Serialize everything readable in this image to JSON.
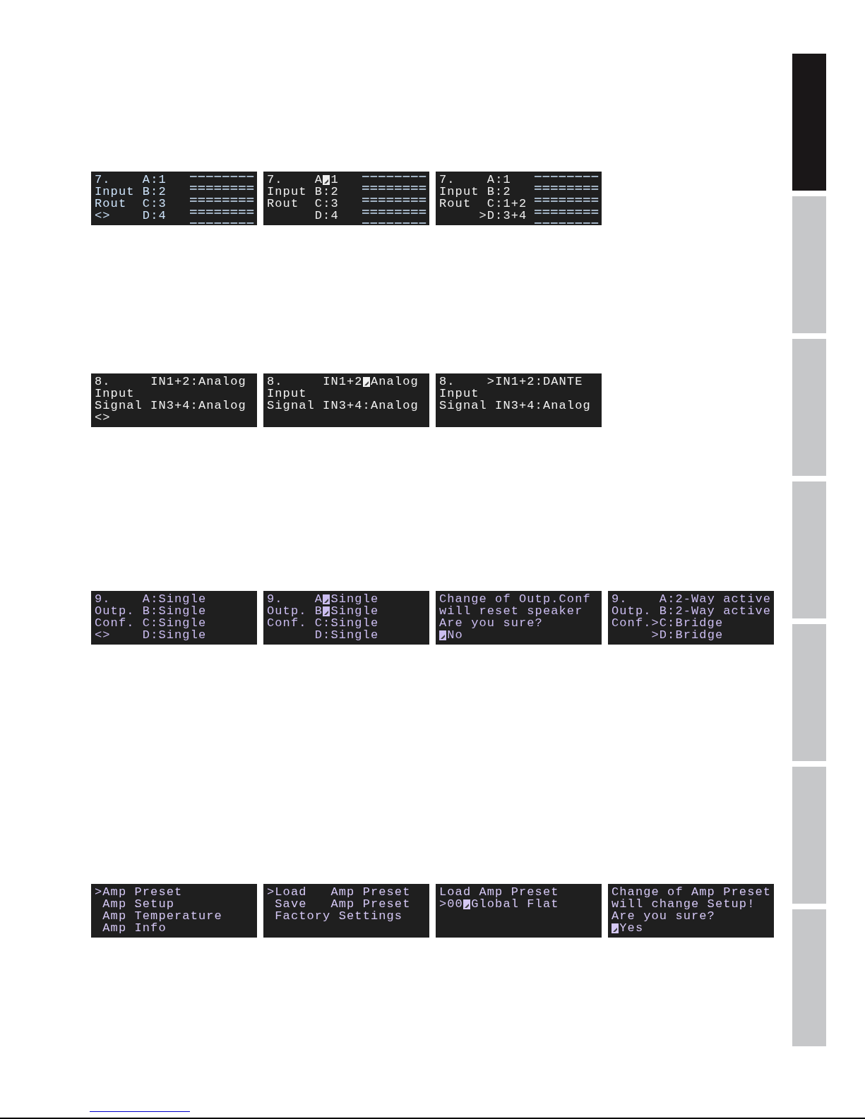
{
  "screen_rows": [
    {
      "screens": [
        {
          "meter": true,
          "lines": [
            [
              {
                "kind": "text",
                "text": "7.    A:1"
              }
            ],
            [
              {
                "kind": "text",
                "text": "Input B:2"
              }
            ],
            [
              {
                "kind": "text",
                "text": "Rout  C:3"
              }
            ],
            [
              {
                "kind": "text",
                "text": "<>    D:4"
              }
            ]
          ]
        },
        {
          "meter": true,
          "lines": [
            [
              {
                "kind": "text",
                "text": "7.    A"
              },
              {
                "kind": "cursor"
              },
              {
                "kind": "text",
                "text": "1"
              }
            ],
            [
              {
                "kind": "text",
                "text": "Input B:2"
              }
            ],
            [
              {
                "kind": "text",
                "text": "Rout  C:3"
              }
            ],
            [
              {
                "kind": "text",
                "text": "      D:4"
              }
            ]
          ]
        },
        {
          "meter": true,
          "lines": [
            [
              {
                "kind": "text",
                "text": "7.    A:1"
              }
            ],
            [
              {
                "kind": "text",
                "text": "Input B:2"
              }
            ],
            [
              {
                "kind": "text",
                "text": "Rout  C:1+2"
              }
            ],
            [
              {
                "kind": "text",
                "text": "     >D:3+4"
              }
            ]
          ]
        }
      ]
    },
    {
      "screens": [
        {
          "lines": [
            [
              {
                "kind": "text",
                "text": "8.     IN1+2:Analog"
              }
            ],
            [
              {
                "kind": "text",
                "text": "Input"
              }
            ],
            [
              {
                "kind": "text",
                "text": "Signal IN3+4:Analog"
              }
            ],
            [
              {
                "kind": "text",
                "text": "<>"
              }
            ]
          ]
        },
        {
          "lines": [
            [
              {
                "kind": "text",
                "text": "8.     IN1+2"
              },
              {
                "kind": "cursor"
              },
              {
                "kind": "text",
                "text": "Analog"
              }
            ],
            [
              {
                "kind": "text",
                "text": "Input"
              }
            ],
            [
              {
                "kind": "text",
                "text": "Signal IN3+4:Analog"
              }
            ]
          ]
        },
        {
          "lines": [
            [
              {
                "kind": "text",
                "text": "8.    >IN1+2:DANTE"
              }
            ],
            [
              {
                "kind": "text",
                "text": "Input"
              }
            ],
            [
              {
                "kind": "text",
                "text": "Signal IN3+4:Analog"
              }
            ]
          ]
        }
      ]
    },
    {
      "screens": [
        {
          "lines": [
            [
              {
                "kind": "text",
                "text": "9.    A:Single"
              }
            ],
            [
              {
                "kind": "text",
                "text": "Outp. B:Single"
              }
            ],
            [
              {
                "kind": "text",
                "text": "Conf. C:Single"
              }
            ],
            [
              {
                "kind": "text",
                "text": "<>    D:Single"
              }
            ]
          ]
        },
        {
          "lines": [
            [
              {
                "kind": "text",
                "text": "9.    A"
              },
              {
                "kind": "cursor"
              },
              {
                "kind": "text",
                "text": "Single"
              }
            ],
            [
              {
                "kind": "text",
                "text": "Outp. B"
              },
              {
                "kind": "cursor"
              },
              {
                "kind": "text",
                "text": "Single"
              }
            ],
            [
              {
                "kind": "text",
                "text": "Conf. C:Single"
              }
            ],
            [
              {
                "kind": "text",
                "text": "      D:Single"
              }
            ]
          ]
        },
        {
          "lines": [
            [
              {
                "kind": "text",
                "text": "Change of Outp.Conf"
              }
            ],
            [
              {
                "kind": "text",
                "text": "will reset speaker"
              }
            ],
            [
              {
                "kind": "text",
                "text": "Are you sure?"
              }
            ],
            [
              {
                "kind": "cursor"
              },
              {
                "kind": "text",
                "text": "No"
              }
            ]
          ]
        },
        {
          "lines": [
            [
              {
                "kind": "text",
                "text": "9.    A:2-Way active"
              }
            ],
            [
              {
                "kind": "text",
                "text": "Outp. B:2-Way active"
              }
            ],
            [
              {
                "kind": "text",
                "text": "Conf.>C:Bridge"
              }
            ],
            [
              {
                "kind": "text",
                "text": "     >D:Bridge"
              }
            ]
          ]
        }
      ]
    },
    {
      "screens": [
        {
          "lines": [
            [
              {
                "kind": "text",
                "text": ">Amp Preset"
              }
            ],
            [
              {
                "kind": "text",
                "text": " Amp Setup"
              }
            ],
            [
              {
                "kind": "text",
                "text": " Amp Temperature"
              }
            ],
            [
              {
                "kind": "text",
                "text": " Amp Info"
              }
            ]
          ]
        },
        {
          "lines": [
            [
              {
                "kind": "text",
                "text": ">Load   Amp Preset"
              }
            ],
            [
              {
                "kind": "text",
                "text": " Save   Amp Preset"
              }
            ],
            [
              {
                "kind": "text",
                "text": " Factory Settings"
              }
            ]
          ]
        },
        {
          "lines": [
            [
              {
                "kind": "text",
                "text": "Load Amp Preset"
              }
            ],
            [
              {
                "kind": "text",
                "text": ">00"
              },
              {
                "kind": "cursor"
              },
              {
                "kind": "text",
                "text": "Global Flat"
              }
            ]
          ]
        },
        {
          "lines": [
            [
              {
                "kind": "text",
                "text": "Change of Amp Preset"
              }
            ],
            [
              {
                "kind": "text",
                "text": "will change Setup!"
              }
            ],
            [
              {
                "kind": "text",
                "text": "Are you sure?"
              }
            ],
            [
              {
                "kind": "cursor"
              },
              {
                "kind": "text",
                "text": "Yes"
              }
            ]
          ]
        }
      ]
    }
  ],
  "side_tabs": [
    {
      "selected": true
    },
    {
      "selected": false
    },
    {
      "selected": false
    },
    {
      "selected": false
    },
    {
      "selected": false
    },
    {
      "selected": false
    },
    {
      "selected": false
    }
  ]
}
